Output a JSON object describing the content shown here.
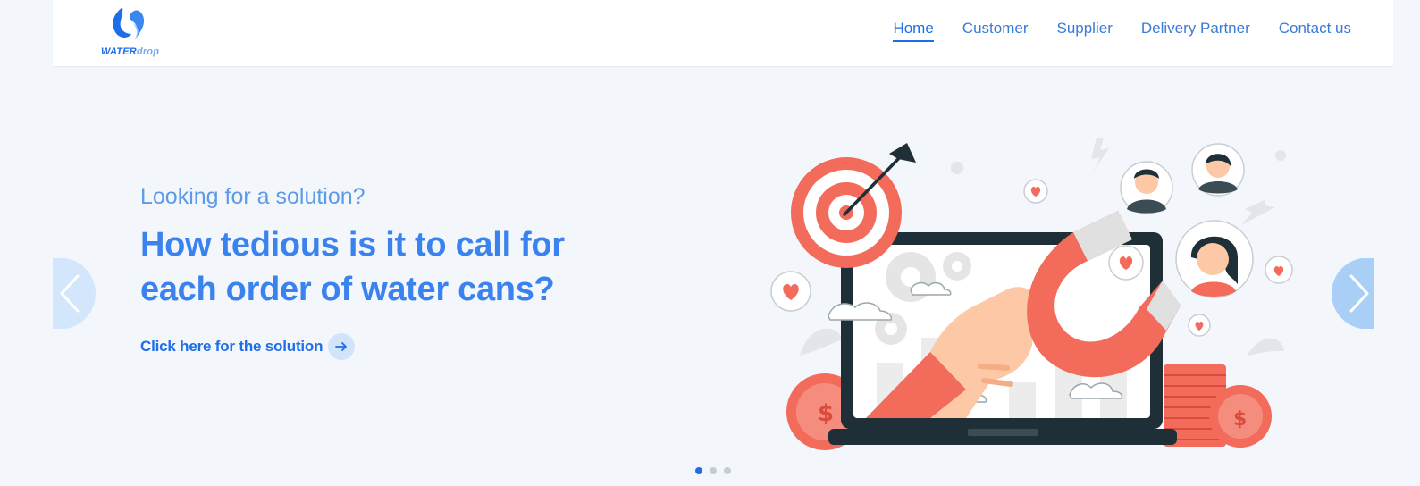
{
  "header": {
    "logo": {
      "brand_strong": "WATER",
      "brand_light": "drop",
      "icon": "water-drop-icon"
    },
    "nav": [
      {
        "label": "Home",
        "active": true
      },
      {
        "label": "Customer",
        "active": false
      },
      {
        "label": "Supplier",
        "active": false
      },
      {
        "label": "Delivery Partner",
        "active": false
      },
      {
        "label": "Contact us",
        "active": false
      }
    ]
  },
  "hero": {
    "subtitle": "Looking for a solution?",
    "headline_line1": "How tedious is it to call for",
    "headline_line2": "each order of water cans?",
    "cta_label": "Click here for the solution",
    "cta_icon": "arrow-right-icon"
  },
  "carousel": {
    "prev_icon": "chevron-left-icon",
    "next_icon": "chevron-right-icon",
    "slide_count": 3,
    "active_slide": 1
  },
  "colors": {
    "primary": "#1d6ee8",
    "headline": "#3a82ee",
    "background": "#f3f6fb",
    "illustration_accent": "#f26b5b"
  }
}
